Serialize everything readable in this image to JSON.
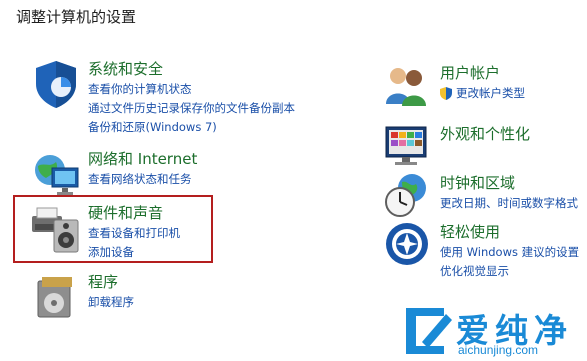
{
  "page_title": "调整计算机的设置",
  "left_categories": [
    {
      "name": "系统和安全",
      "icon": "shield-icon",
      "links": [
        "查看你的计算机状态",
        "通过文件历史记录保存你的文件备份副本",
        "备份和还原(Windows 7)"
      ]
    },
    {
      "name": "网络和 Internet",
      "icon": "network-globe-icon",
      "links": [
        "查看网络状态和任务"
      ]
    },
    {
      "name": "硬件和声音",
      "icon": "printer-speaker-icon",
      "links": [
        "查看设备和打印机",
        "添加设备"
      ]
    },
    {
      "name": "程序",
      "icon": "programs-icon",
      "links": [
        "卸载程序"
      ]
    }
  ],
  "right_categories": [
    {
      "name": "用户帐户",
      "icon": "users-icon",
      "links": [
        "更改帐户类型"
      ]
    },
    {
      "name": "外观和个性化",
      "icon": "monitor-palette-icon",
      "links": []
    },
    {
      "name": "时钟和区域",
      "icon": "clock-globe-icon",
      "links": [
        "更改日期、时间或数字格式"
      ]
    },
    {
      "name": "轻松使用",
      "icon": "ease-of-access-icon",
      "links": [
        "使用 Windows 建议的设置",
        "优化视觉显示"
      ]
    }
  ],
  "watermark": {
    "brand": "爱纯净",
    "url": "aichunjing.com"
  },
  "colors": {
    "category": "#1c6e2c",
    "link": "#1a4fa8",
    "highlight": "#b41e1e",
    "watermark": "#1a8ad6"
  }
}
